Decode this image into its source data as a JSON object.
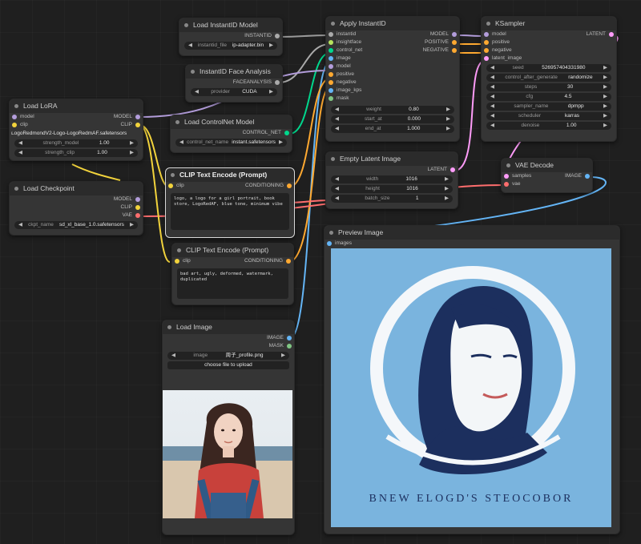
{
  "nodes": {
    "load_instantid_model": {
      "title": "Load InstantID Model",
      "output": "INSTANTID",
      "widget_label": "instantid_file",
      "widget_value": "ip-adapter.bin"
    },
    "instantid_face_analysis": {
      "title": "InstantID Face Analysis",
      "output": "FACEANALYSIS",
      "widget_label": "provider",
      "widget_value": "CUDA"
    },
    "load_lora": {
      "title": "Load LoRA",
      "inputs": [
        "model",
        "clip"
      ],
      "outputs": [
        "MODEL",
        "CLIP"
      ],
      "lora_name": "LogoRedmondV2-Logo-LogoRedmAF.safetensors",
      "strength_model_label": "strength_model",
      "strength_model": "1.00",
      "strength_clip_label": "strength_clip",
      "strength_clip": "1.00"
    },
    "load_controlnet": {
      "title": "Load ControlNet Model",
      "output": "CONTROL_NET",
      "widget_label": "control_net_name",
      "widget_value": "instant.safetensors"
    },
    "load_checkpoint": {
      "title": "Load Checkpoint",
      "outputs": [
        "MODEL",
        "CLIP",
        "VAE"
      ],
      "widget_label": "ckpt_name",
      "widget_value": "sd_xl_base_1.0.safetensors"
    },
    "clip_text_pos": {
      "title": "CLIP Text Encode (Prompt)",
      "input": "clip",
      "output": "CONDITIONING",
      "text": "logo, a logo for a girl portrait, book store, LogoRedAF, blue tone, minimum vibe"
    },
    "clip_text_neg": {
      "title": "CLIP Text Encode (Prompt)",
      "input": "clip",
      "output": "CONDITIONING",
      "text": "bad art, ugly, deformed, watermark, duplicated"
    },
    "apply_instantid": {
      "title": "Apply InstantID",
      "inputs": [
        "instantid",
        "insightface",
        "control_net",
        "image",
        "model",
        "positive",
        "negative",
        "image_kps",
        "mask"
      ],
      "outputs": [
        "MODEL",
        "POSITIVE",
        "NEGATIVE"
      ],
      "weight_label": "weight",
      "weight": "0.80",
      "start_at_label": "start_at",
      "start_at": "0.000",
      "end_at_label": "end_at",
      "end_at": "1.000"
    },
    "empty_latent": {
      "title": "Empty Latent Image",
      "output": "LATENT",
      "width_label": "width",
      "width": "1016",
      "height_label": "height",
      "height": "1016",
      "batch_label": "batch_size",
      "batch": "1"
    },
    "ksampler": {
      "title": "KSampler",
      "inputs": [
        "model",
        "positive",
        "negative",
        "latent_image"
      ],
      "output": "LATENT",
      "widgets": [
        {
          "label": "seed",
          "value": "526957404331980"
        },
        {
          "label": "control_after_generate",
          "value": "randomize"
        },
        {
          "label": "steps",
          "value": "30"
        },
        {
          "label": "cfg",
          "value": "4.5"
        },
        {
          "label": "sampler_name",
          "value": "dpmpp"
        },
        {
          "label": "scheduler",
          "value": "karras"
        },
        {
          "label": "denoise",
          "value": "1.00"
        }
      ]
    },
    "vae_decode": {
      "title": "VAE Decode",
      "inputs": [
        "samples",
        "vae"
      ],
      "output": "IMAGE"
    },
    "load_image": {
      "title": "Load Image",
      "outputs": [
        "IMAGE",
        "MASK"
      ],
      "widget_label": "image",
      "widget_value": "周子_profile.png",
      "button": "choose file to upload"
    },
    "preview_image": {
      "title": "Preview Image",
      "input": "images",
      "caption": "BNEW ELOGD'S STEOCOBOR"
    }
  },
  "colors": {
    "model": "#b39ddb",
    "clip": "#f2d33c",
    "vae": "#ff6e6e",
    "conditioning": "#ffa931",
    "latent": "#ff9cf9",
    "image": "#64b5f6",
    "control_net": "#00d78d"
  },
  "icons": [
    "node-dot-icon",
    "arrow-left-icon",
    "arrow-right-icon"
  ]
}
